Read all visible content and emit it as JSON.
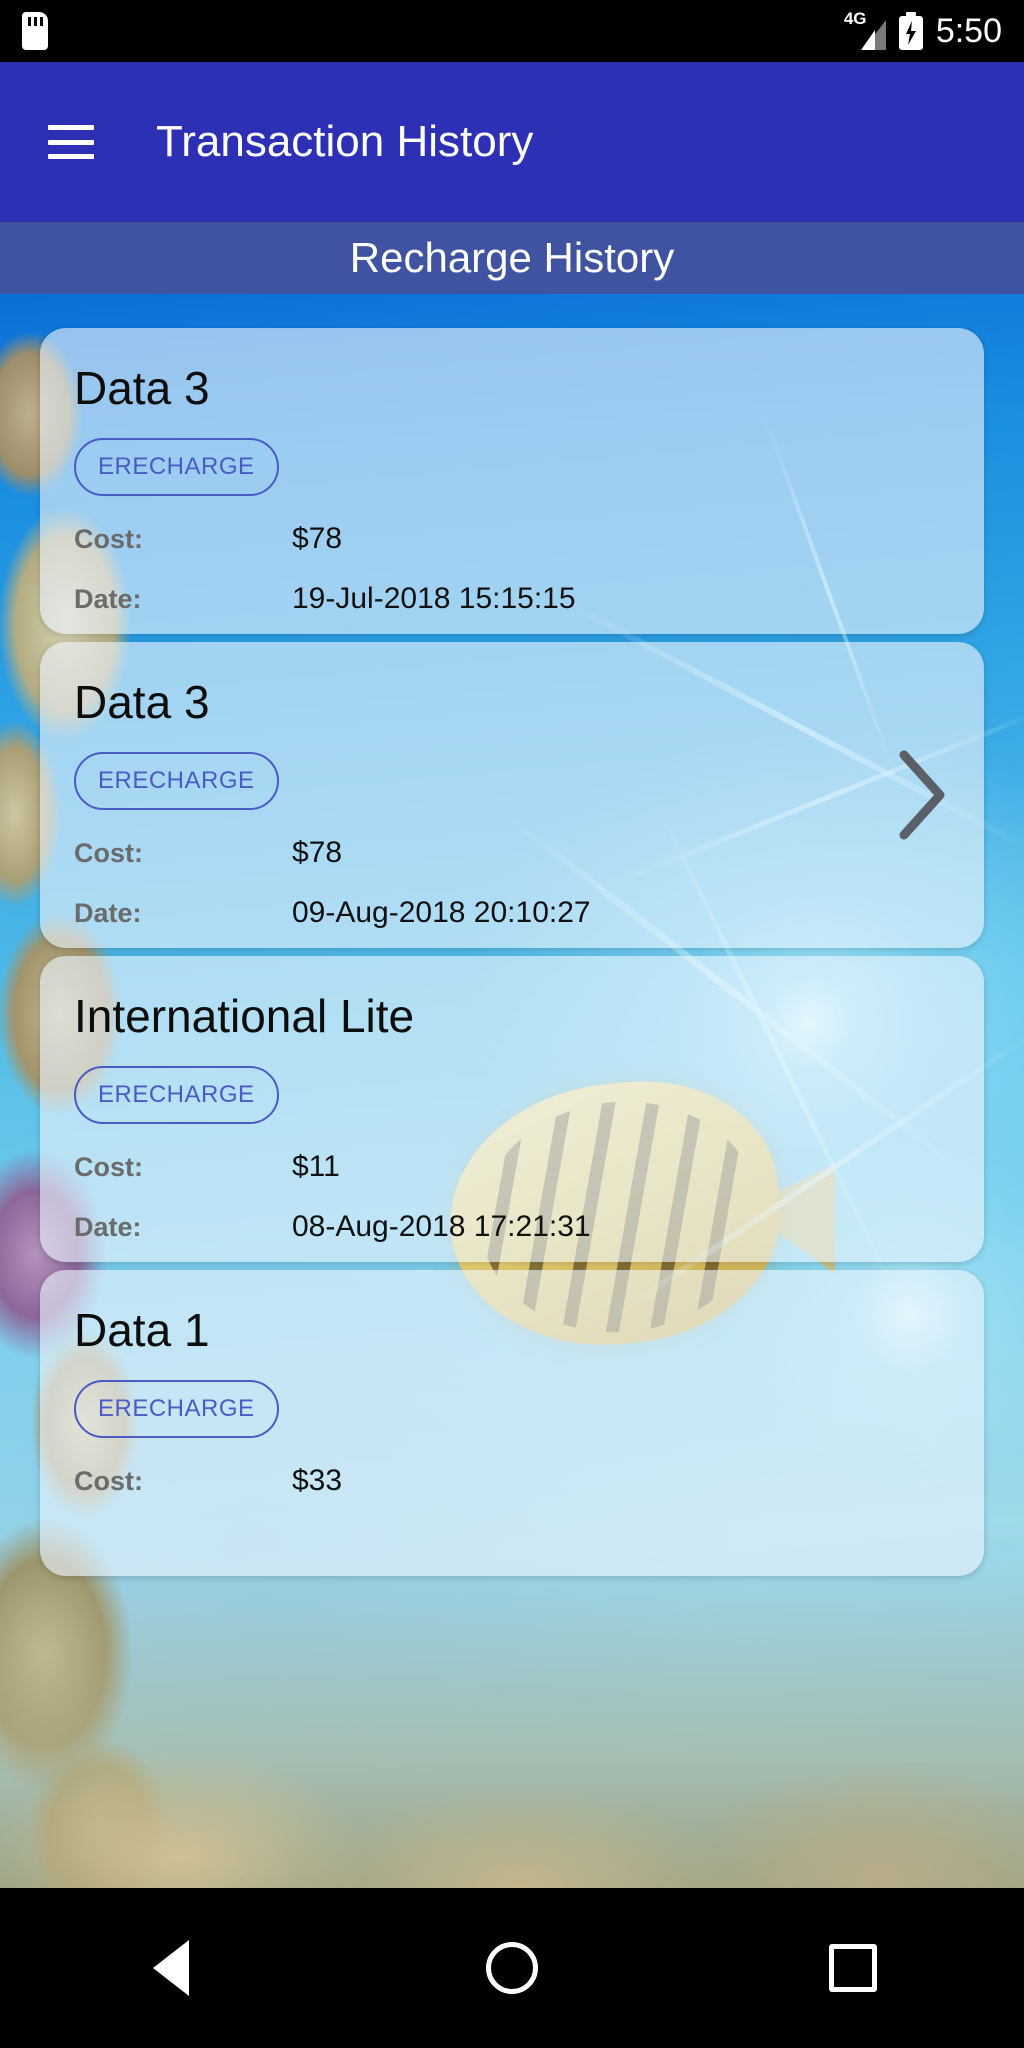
{
  "status_bar": {
    "sd_icon": "sd-card-icon",
    "network_label": "4G",
    "battery_icon": "battery-charging-icon",
    "time": "5:50"
  },
  "app_bar": {
    "menu_icon": "hamburger-menu-icon",
    "title": "Transaction History",
    "background_color": "#2D2FB5"
  },
  "sub_header": {
    "title": "Recharge History",
    "background_color": "#3F53A0"
  },
  "theme": {
    "chip_color": "#4A5BC4",
    "label_color": "#6B6B6B",
    "value_color": "#111111",
    "card_background": "rgba(236,243,252,0.62)"
  },
  "list": {
    "labels": {
      "cost": "Cost:",
      "date": "Date:"
    },
    "chevron_icon": "chevron-right-icon",
    "items": [
      {
        "title": "Data 3",
        "chip": "ERECHARGE",
        "cost": "$78",
        "date": "19-Jul-2018 15:15:15",
        "has_chevron": false
      },
      {
        "title": "Data 3",
        "chip": "ERECHARGE",
        "cost": "$78",
        "date": "09-Aug-2018 20:10:27",
        "has_chevron": true
      },
      {
        "title": "International Lite",
        "chip": "ERECHARGE",
        "cost": "$11",
        "date": "08-Aug-2018 17:21:31",
        "has_chevron": false
      },
      {
        "title": "Data 1",
        "chip": "ERECHARGE",
        "cost": "$33",
        "date": "",
        "has_chevron": false
      }
    ]
  },
  "nav_bar": {
    "back_icon": "back-triangle-icon",
    "home_icon": "home-circle-icon",
    "recents_icon": "recents-square-icon"
  }
}
